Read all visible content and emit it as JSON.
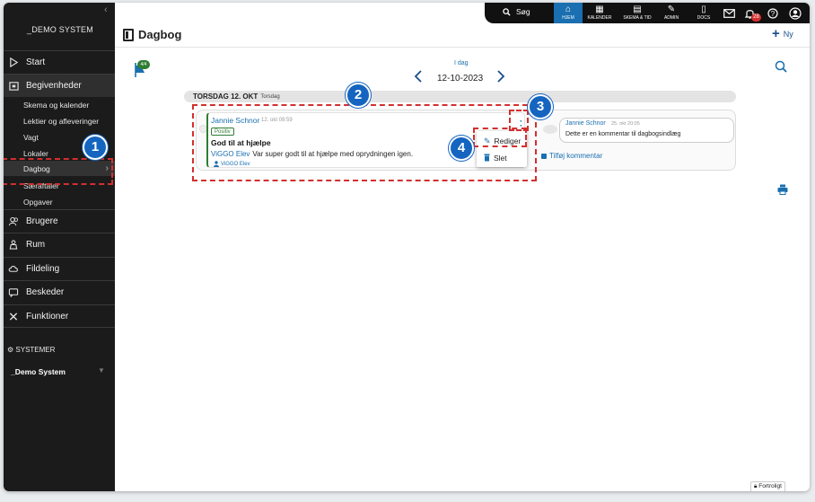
{
  "sidebar": {
    "brand": "_DEMO SYSTEM",
    "items": [
      {
        "label": "Start",
        "icon": "play-icon"
      },
      {
        "label": "Begivenheder",
        "icon": "calendar-icon"
      },
      {
        "label": "Brugere",
        "icon": "users-icon"
      },
      {
        "label": "Rum",
        "icon": "room-icon"
      },
      {
        "label": "Fildeling",
        "icon": "cloud-icon"
      },
      {
        "label": "Beskeder",
        "icon": "messages-icon"
      },
      {
        "label": "Funktioner",
        "icon": "tools-icon"
      }
    ],
    "sub_items": [
      "Skema og kalender",
      "Lektier og afleveringer",
      "Vagt",
      "Lokaler",
      "Dagbog",
      "Særaftaler",
      "Opgaver"
    ],
    "systems_heading": "SYSTEMER",
    "system_item": "_Demo System"
  },
  "topbar": {
    "search_label": "Søg",
    "nav": [
      {
        "label": "HJEM",
        "icon": "home-icon"
      },
      {
        "label": "KALENDER",
        "icon": "calendar-icon"
      },
      {
        "label": "SKEMA & TID",
        "icon": "schedule-icon"
      },
      {
        "label": "ADMIN",
        "icon": "wrench-icon"
      },
      {
        "label": "DOCS",
        "icon": "document-icon"
      }
    ],
    "notification_count": "28"
  },
  "header": {
    "title": "Dagbog",
    "new_label": "Ny"
  },
  "content": {
    "flag_badge": "4/4",
    "today_label": "I dag",
    "current_date": "12-10-2023",
    "day_label": "TORSDAG 12. OKT",
    "day_sub": "Torsdag",
    "post": {
      "author": "Jannie Schnor",
      "time": "12. okt 09:59",
      "tag": "Positiv",
      "title": "God til at hjælpe",
      "body_who": "ViGGO Elev",
      "body": "Var super godt til at hjælpe med oprydningen igen.",
      "tagged": "ViGGO Elev"
    },
    "menu": {
      "edit_label": "Rediger",
      "delete_label": "Slet"
    },
    "comment": {
      "author": "Jannie Schnor",
      "time": "25. okt 20:05",
      "text": "Dette er en kommentar til dagbogsindlæg"
    },
    "add_comment_label": "Tilføj kommentar",
    "confidential_label": "Fortroligt"
  },
  "annotations": [
    "1",
    "2",
    "3",
    "4"
  ],
  "colors": {
    "accent": "#1a6fb0",
    "annotation_red": "#d32f2f",
    "annotation_blue": "#1565c0",
    "positive_green": "#2e7d32"
  }
}
